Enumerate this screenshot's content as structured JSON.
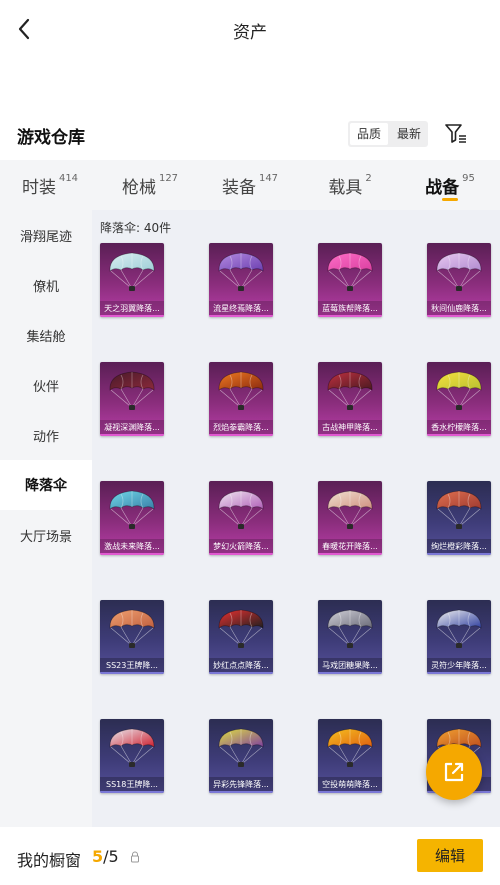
{
  "header": {
    "title": "资产",
    "back_icon": "chevron-left-icon"
  },
  "warehouse": {
    "title": "游戏仓库",
    "sort_options": [
      "品质",
      "最新"
    ],
    "sort_selected": "品质",
    "filter_icon": "filter-list-icon"
  },
  "categories": [
    {
      "label": "时装",
      "count": "414"
    },
    {
      "label": "枪械",
      "count": "127"
    },
    {
      "label": "装备",
      "count": "147"
    },
    {
      "label": "载具",
      "count": "2"
    },
    {
      "label": "战备",
      "count": "95",
      "active": true
    }
  ],
  "sidebar": [
    {
      "label": "滑翔尾迹"
    },
    {
      "label": "僚机"
    },
    {
      "label": "集结舱"
    },
    {
      "label": "伙伴"
    },
    {
      "label": "动作"
    },
    {
      "label": "降落伞",
      "active": true
    },
    {
      "label": "大厅场景"
    }
  ],
  "section": {
    "label": "降落伞: 40件"
  },
  "items": [
    {
      "name": "天之羽翼降落...",
      "tier": "purple",
      "colors": [
        "#d8ecf0",
        "#9fd0d8"
      ]
    },
    {
      "name": "流星终焉降落...",
      "tier": "purple",
      "colors": [
        "#b48be0",
        "#6b3fb0"
      ]
    },
    {
      "name": "蓝莓族帮降落...",
      "tier": "purple",
      "colors": [
        "#ff6ec7",
        "#d93fa0"
      ]
    },
    {
      "name": "秋间仙鹿降落...",
      "tier": "purple",
      "colors": [
        "#e8c8f0",
        "#b08ad0"
      ]
    },
    {
      "name": "凝视深渊降落...",
      "tier": "purple",
      "colors": [
        "#4a1a2a",
        "#8a2a3a"
      ]
    },
    {
      "name": "烈焰拳霸降落...",
      "tier": "purple",
      "colors": [
        "#f07a20",
        "#8a2a10"
      ]
    },
    {
      "name": "古战神甲降落...",
      "tier": "purple",
      "colors": [
        "#c03040",
        "#4a1a20"
      ]
    },
    {
      "name": "香水柠檬降落...",
      "tier": "purple",
      "colors": [
        "#f5e040",
        "#b8c030"
      ]
    },
    {
      "name": "激战未来降落...",
      "tier": "purple",
      "colors": [
        "#70d8e8",
        "#3a80a8"
      ]
    },
    {
      "name": "梦幻火箭降落...",
      "tier": "purple",
      "colors": [
        "#f0e6f0",
        "#b060b8"
      ]
    },
    {
      "name": "春暖花开降落...",
      "tier": "purple",
      "colors": [
        "#f0e0d0",
        "#d09080"
      ]
    },
    {
      "name": "绚烂橙彩降落...",
      "tier": "blue",
      "colors": [
        "#e07050",
        "#a03a30"
      ]
    },
    {
      "name": "SS23王牌降...",
      "tier": "blue",
      "colors": [
        "#f0a070",
        "#c06040"
      ]
    },
    {
      "name": "妙红点点降落...",
      "tier": "blue",
      "colors": [
        "#e83030",
        "#202020"
      ]
    },
    {
      "name": "马戏团糖果降...",
      "tier": "blue",
      "colors": [
        "#d0d0d8",
        "#6a6a78"
      ]
    },
    {
      "name": "灵符少年降落...",
      "tier": "blue",
      "colors": [
        "#f0f0f0",
        "#3040a0"
      ]
    },
    {
      "name": "SS18王牌降...",
      "tier": "blue",
      "colors": [
        "#e8e8ee",
        "#d02030"
      ]
    },
    {
      "name": "异彩先锋降落...",
      "tier": "blue",
      "colors": [
        "#e0e040",
        "#8040a0"
      ]
    },
    {
      "name": "空投萌萌降落...",
      "tier": "blue",
      "colors": [
        "#f5c020",
        "#e06010"
      ]
    },
    {
      "name": "",
      "tier": "blue",
      "colors": [
        "#f0a030",
        "#c05020"
      ]
    }
  ],
  "share_fab": {
    "icon": "share-external-icon"
  },
  "bottom_bar": {
    "label": "我的橱窗",
    "current": "5",
    "total": "/5",
    "lock_icon": "lock-icon",
    "edit_label": "编辑"
  },
  "colors": {
    "accent": "#f5a800",
    "epic": "#8a2d7c",
    "rare": "#3e3c78"
  }
}
